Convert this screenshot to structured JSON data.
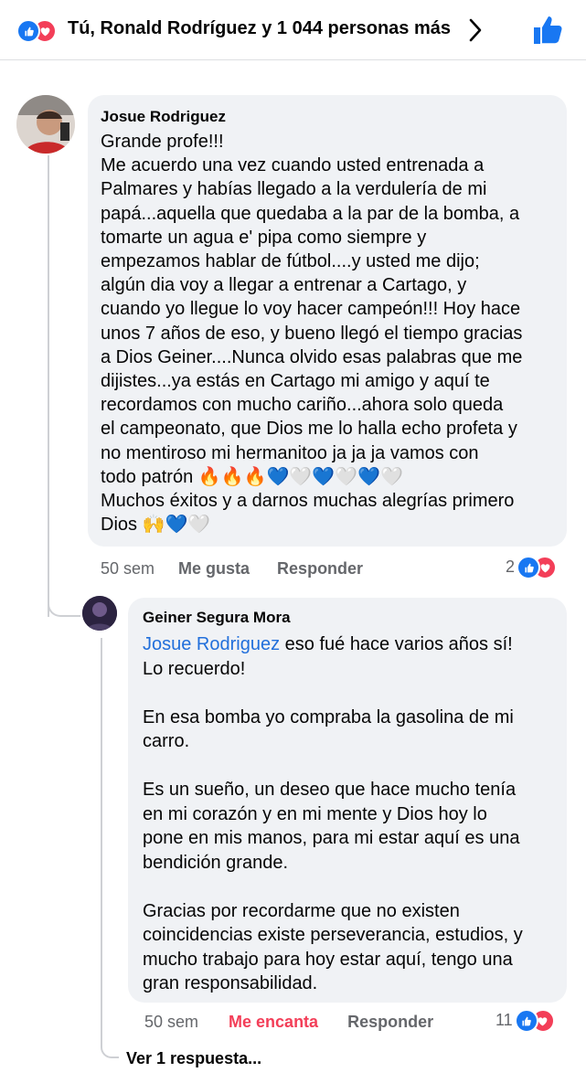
{
  "reactions": {
    "summary": "Tú, Ronald Rodríguez y 1 044 personas más",
    "icons": [
      "like-icon",
      "love-icon"
    ],
    "colors": {
      "like": "#1877f2",
      "love": "#f33e58"
    }
  },
  "comments": [
    {
      "author": "Josue Rodriguez",
      "text": "Grande profe!!!\nMe acuerdo una vez cuando usted entrenada a\nPalmares y habías llegado a la verdulería de mi\npapá...aquella que quedaba a la par de la bomba, a\ntomarte un agua e' pipa como siempre y\nempezamos hablar de fútbol....y usted me dijo;\nalgún dia voy a llegar a entrenar a Cartago, y\ncuando yo llegue lo voy hacer campeón!!! Hoy hace\nunos 7 años de eso, y bueno llegó el tiempo gracias\na Dios Geiner....Nunca olvido esas palabras que me\ndijistes...ya estás en Cartago mi amigo y aquí te\nrecordamos con mucho cariño...ahora solo queda\nel campeonato, que Dios me lo halla echo profeta y\nno mentiroso mi hermanitoo ja ja ja vamos con\ntodo patrón 🔥🔥🔥💙🤍💙🤍💙🤍\nMuchos éxitos y a darnos muchas alegrías primero\nDios 🙌💙🤍",
      "time": "50 sem",
      "like_label": "Me gusta",
      "reply_label": "Responder",
      "reaction_count": "2"
    },
    {
      "author": "Geiner Segura Mora",
      "mention": "Josue Rodriguez",
      "text": " eso fué hace varios años sí!\nLo recuerdo!\n\nEn esa bomba yo compraba la gasolina de mi\ncarro.\n\nEs un sueño, un deseo que hace mucho tenía\nen mi corazón y en mi mente y Dios hoy lo\npone en mis manos, para mi estar aquí es una\nbendición grande.\n\nGracias por recordarme que no existen\ncoincidencias existe perseverancia, estudios, y\nmucho trabajo para hoy estar aquí, tengo una\ngran responsabilidad.",
      "time": "50 sem",
      "like_label": "Me encanta",
      "reply_label": "Responder",
      "reaction_count": "11"
    }
  ],
  "see_replies": "Ver 1 respuesta..."
}
